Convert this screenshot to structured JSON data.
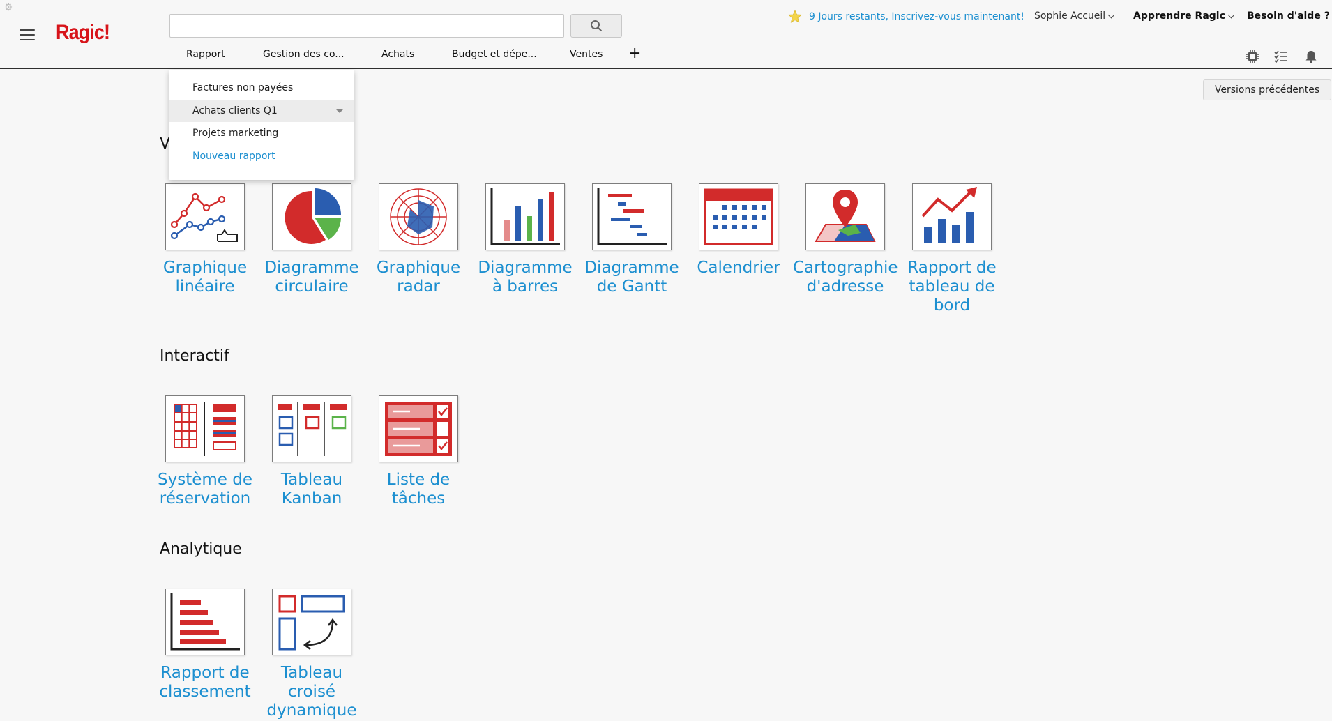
{
  "header": {
    "logo": "Ragic!",
    "search": {
      "value": "",
      "placeholder": ""
    },
    "trial_text": "9 Jours restants, Inscrivez-vous maintenant!",
    "user_name": "Sophie Accueil",
    "learn_label": "Apprendre Ragic",
    "help_label": "Besoin d'aide ?",
    "tabs": [
      "Rapport",
      "Gestion des co...",
      "Achats",
      "Budget et dépe...",
      "Ventes"
    ],
    "add_tab": "+",
    "icons": [
      "settings-chip-icon",
      "task-list-icon",
      "bell-icon"
    ]
  },
  "dropdown": {
    "items": [
      "Factures non payées",
      "Achats clients Q1",
      "Projets marketing"
    ],
    "new_report": "Nouveau rapport"
  },
  "versions_button": "Versions précédentes",
  "sections": [
    {
      "title": "V",
      "tiles": [
        "Graphique linéaire",
        "Diagramme circulaire",
        "Graphique radar",
        "Diagramme à barres",
        "Diagramme de Gantt",
        "Calendrier",
        "Cartographie d'adresse",
        "Rapport de tableau de bord"
      ]
    },
    {
      "title": "Interactif",
      "tiles": [
        "Système de réservation",
        "Tableau Kanban",
        "Liste de tâches"
      ]
    },
    {
      "title": "Analytique",
      "tiles": [
        "Rapport de classement",
        "Tableau croisé dynamique"
      ]
    }
  ],
  "colors": {
    "brand": "#d7141a",
    "link": "#1c8fd0",
    "chart_blue": "#2a5db0",
    "chart_green": "#5bb34a"
  }
}
